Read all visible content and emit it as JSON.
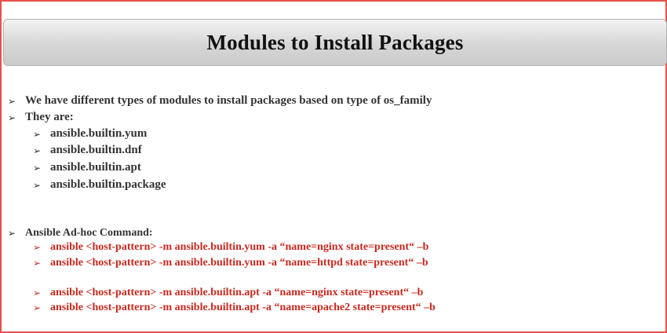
{
  "slide": {
    "title": "Modules to Install Packages",
    "bullet_glyph": "➢",
    "intro": [
      "We have different types of modules to install packages based on type of os_family",
      "They are:"
    ],
    "modules": [
      "ansible.builtin.yum",
      "ansible.builtin.dnf",
      "ansible.builtin.apt",
      "ansible.builtin.package"
    ],
    "adhoc_heading": "Ansible Ad-hoc Command:",
    "commands": [
      "ansible <host-pattern> -m ansible.builtin.yum  -a “name=nginx state=present“ –b",
      "ansible <host-pattern> -m ansible.builtin.yum  -a “name=httpd state=present“ –b",
      "ansible  <host-pattern> -m ansible.builtin.apt  -a “name=nginx state=present“ –b",
      "ansible  <host-pattern> -m ansible.builtin.apt  -a “name=apache2 state=present“ –b"
    ]
  },
  "colors": {
    "border": "#e8504a",
    "text": "#333333",
    "command_red": "#c6291e",
    "title_bar": "#d6d6d6"
  }
}
